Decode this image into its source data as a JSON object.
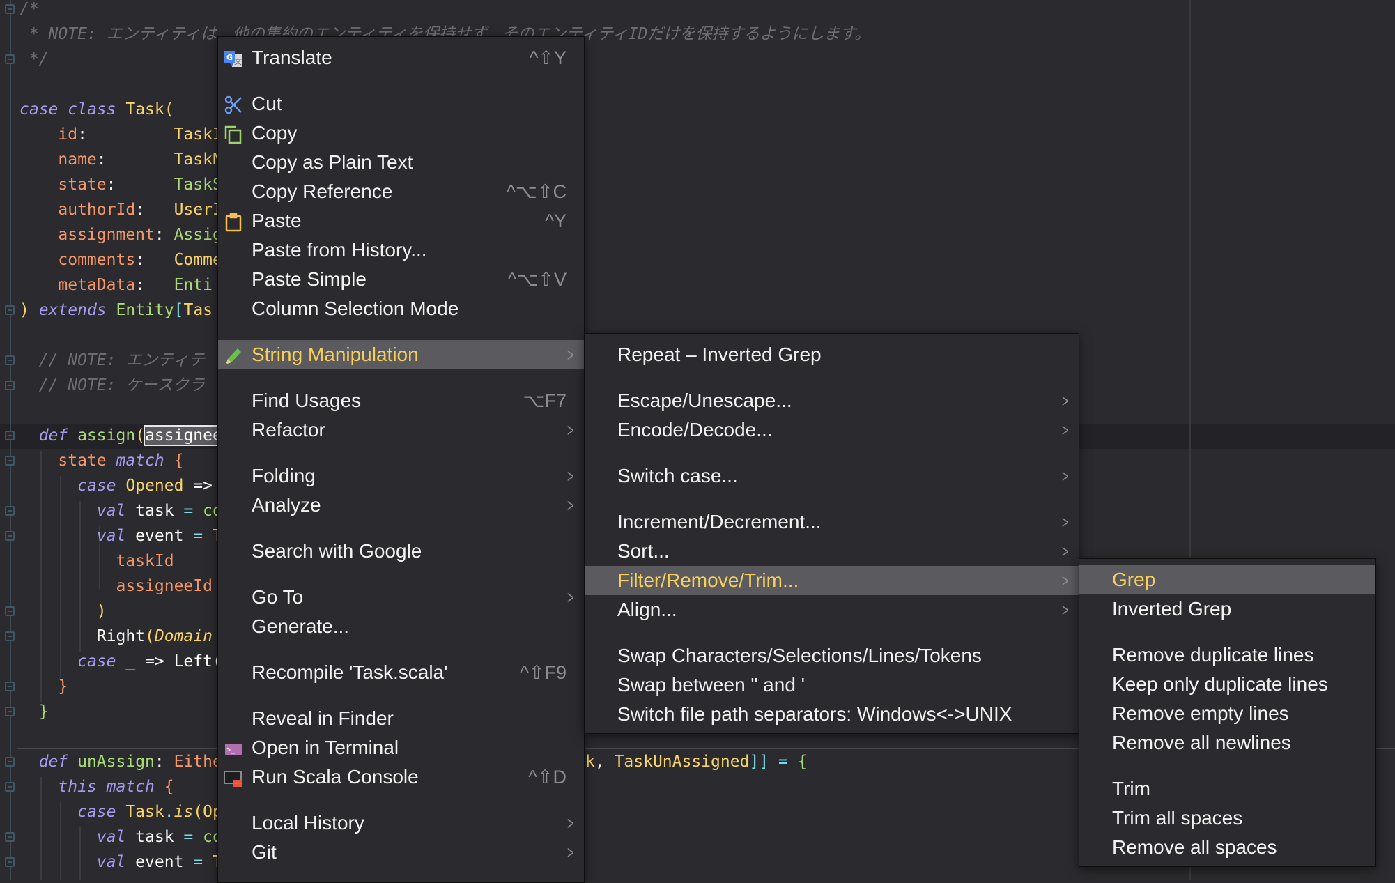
{
  "editor": {
    "lines": [
      {
        "n": 0,
        "tokens": [
          {
            "t": "/*",
            "k": "c"
          }
        ]
      },
      {
        "n": 1,
        "tokens": [
          {
            "t": " * NOTE: エンティティは、他の集約のエンティティを保持せず、そのエンティティIDだけを保持するようにします。",
            "k": "c"
          }
        ]
      },
      {
        "n": 2,
        "tokens": [
          {
            "t": " */",
            "k": "c"
          }
        ]
      },
      {
        "n": 4,
        "tokens": [
          {
            "t": "case",
            "k": "kw"
          },
          {
            "t": " ",
            "k": "pl"
          },
          {
            "t": "class",
            "k": "kw"
          },
          {
            "t": " ",
            "k": "pl"
          },
          {
            "t": "Task",
            "k": "ty"
          },
          {
            "t": "(",
            "k": "ty"
          }
        ]
      },
      {
        "n": 5,
        "tokens": [
          {
            "t": "    ",
            "k": "pl"
          },
          {
            "t": "id",
            "k": "pa"
          },
          {
            "t": ":         ",
            "k": "pl"
          },
          {
            "t": "TaskI",
            "k": "ty"
          }
        ]
      },
      {
        "n": 6,
        "tokens": [
          {
            "t": "    ",
            "k": "pl"
          },
          {
            "t": "name",
            "k": "pa"
          },
          {
            "t": ":       ",
            "k": "pl"
          },
          {
            "t": "TaskN",
            "k": "ty"
          }
        ]
      },
      {
        "n": 7,
        "tokens": [
          {
            "t": "    ",
            "k": "pl"
          },
          {
            "t": "state",
            "k": "pa"
          },
          {
            "t": ":      ",
            "k": "pl"
          },
          {
            "t": "TaskS",
            "k": "gr"
          }
        ]
      },
      {
        "n": 8,
        "tokens": [
          {
            "t": "    ",
            "k": "pl"
          },
          {
            "t": "authorId",
            "k": "pa"
          },
          {
            "t": ":   ",
            "k": "pl"
          },
          {
            "t": "UserI",
            "k": "ty"
          }
        ]
      },
      {
        "n": 9,
        "tokens": [
          {
            "t": "    ",
            "k": "pl"
          },
          {
            "t": "assignment",
            "k": "pa"
          },
          {
            "t": ": ",
            "k": "pl"
          },
          {
            "t": "Assig",
            "k": "gr"
          }
        ]
      },
      {
        "n": 10,
        "tokens": [
          {
            "t": "    ",
            "k": "pl"
          },
          {
            "t": "comments",
            "k": "pa"
          },
          {
            "t": ":   ",
            "k": "pl"
          },
          {
            "t": "Comme",
            "k": "ty"
          }
        ]
      },
      {
        "n": 11,
        "tokens": [
          {
            "t": "    ",
            "k": "pl"
          },
          {
            "t": "metaData",
            "k": "pa"
          },
          {
            "t": ":   ",
            "k": "pl"
          },
          {
            "t": "Enti",
            "k": "gr"
          }
        ]
      },
      {
        "n": 12,
        "tokens": [
          {
            "t": ")",
            "k": "ty"
          },
          {
            "t": " ",
            "k": "pl"
          },
          {
            "t": "extends",
            "k": "kw"
          },
          {
            "t": " ",
            "k": "pl"
          },
          {
            "t": "Entity",
            "k": "gr"
          },
          {
            "t": "[",
            "k": "op"
          },
          {
            "t": "Tas",
            "k": "ty"
          }
        ]
      },
      {
        "n": 14,
        "tokens": [
          {
            "t": "  // NOTE: エンティテ",
            "k": "c"
          }
        ]
      },
      {
        "n": 15,
        "tokens": [
          {
            "t": "  // NOTE: ケースクラ",
            "k": "c"
          }
        ]
      },
      {
        "n": 17,
        "tokens": [
          {
            "t": "  ",
            "k": "pl"
          },
          {
            "t": "def",
            "k": "kw"
          },
          {
            "t": " ",
            "k": "pl"
          },
          {
            "t": "assign",
            "k": "gr"
          },
          {
            "t": "(",
            "k": "ty"
          },
          {
            "t": "assignee",
            "k": "sel"
          }
        ]
      },
      {
        "n": 18,
        "tokens": [
          {
            "t": "    ",
            "k": "pl"
          },
          {
            "t": "state",
            "k": "pa"
          },
          {
            "t": " ",
            "k": "pl"
          },
          {
            "t": "match",
            "k": "kw"
          },
          {
            "t": " ",
            "k": "pl"
          },
          {
            "t": "{",
            "k": "pa"
          }
        ]
      },
      {
        "n": 19,
        "tokens": [
          {
            "t": "      ",
            "k": "pl"
          },
          {
            "t": "case",
            "k": "kw"
          },
          {
            "t": " ",
            "k": "pl"
          },
          {
            "t": "Opened",
            "k": "ty"
          },
          {
            "t": " =>",
            "k": "pl"
          }
        ]
      },
      {
        "n": 20,
        "tokens": [
          {
            "t": "        ",
            "k": "pl"
          },
          {
            "t": "val",
            "k": "kw"
          },
          {
            "t": " task ",
            "k": "pl"
          },
          {
            "t": "=",
            "k": "op"
          },
          {
            "t": " ",
            "k": "pl"
          },
          {
            "t": "co",
            "k": "gr"
          }
        ]
      },
      {
        "n": 21,
        "tokens": [
          {
            "t": "        ",
            "k": "pl"
          },
          {
            "t": "val",
            "k": "kw"
          },
          {
            "t": " event ",
            "k": "pl"
          },
          {
            "t": "=",
            "k": "op"
          },
          {
            "t": " T",
            "k": "ty"
          }
        ]
      },
      {
        "n": 22,
        "tokens": [
          {
            "t": "          ",
            "k": "pl"
          },
          {
            "t": "taskId",
            "k": "pa"
          }
        ]
      },
      {
        "n": 23,
        "tokens": [
          {
            "t": "          ",
            "k": "pl"
          },
          {
            "t": "assigneeId",
            "k": "pa"
          }
        ]
      },
      {
        "n": 24,
        "tokens": [
          {
            "t": "        ",
            "k": "pl"
          },
          {
            "t": ")",
            "k": "ty"
          }
        ]
      },
      {
        "n": 25,
        "tokens": [
          {
            "t": "        Right",
            "k": "pl"
          },
          {
            "t": "(",
            "k": "ty"
          },
          {
            "t": "Domain",
            "k": "tyi"
          }
        ]
      },
      {
        "n": 26,
        "tokens": [
          {
            "t": "      ",
            "k": "pl"
          },
          {
            "t": "case",
            "k": "kw"
          },
          {
            "t": " _ => Left(",
            "k": "pl"
          }
        ]
      },
      {
        "n": 27,
        "tokens": [
          {
            "t": "    ",
            "k": "pl"
          },
          {
            "t": "}",
            "k": "pa"
          }
        ]
      },
      {
        "n": 28,
        "tokens": [
          {
            "t": "  ",
            "k": "pl"
          },
          {
            "t": "}",
            "k": "gr"
          }
        ]
      },
      {
        "n": 30,
        "tokens": [
          {
            "t": "  ",
            "k": "pl"
          },
          {
            "t": "def",
            "k": "kw"
          },
          {
            "t": " ",
            "k": "pl"
          },
          {
            "t": "unAssign",
            "k": "gr"
          },
          {
            "t": ": ",
            "k": "pl"
          },
          {
            "t": "Eithe",
            "k": "pa"
          }
        ],
        "suffix": [
          {
            "t": "k",
            "k": "ty"
          },
          {
            "t": ", ",
            "k": "pl"
          },
          {
            "t": "TaskUnAssigned",
            "k": "ty"
          },
          {
            "t": "]]",
            "k": "op"
          },
          {
            "t": " = ",
            "k": "op"
          },
          {
            "t": "{",
            "k": "gr"
          }
        ]
      },
      {
        "n": 31,
        "tokens": [
          {
            "t": "    ",
            "k": "pl"
          },
          {
            "t": "this",
            "k": "kw"
          },
          {
            "t": " ",
            "k": "pl"
          },
          {
            "t": "match",
            "k": "kw"
          },
          {
            "t": " ",
            "k": "pl"
          },
          {
            "t": "{",
            "k": "pa"
          }
        ]
      },
      {
        "n": 32,
        "tokens": [
          {
            "t": "      ",
            "k": "pl"
          },
          {
            "t": "case",
            "k": "kw"
          },
          {
            "t": " ",
            "k": "pl"
          },
          {
            "t": "Task",
            "k": "ty"
          },
          {
            "t": ".",
            "k": "op"
          },
          {
            "t": "is",
            "k": "tyi"
          },
          {
            "t": "(Op",
            "k": "ty"
          }
        ]
      },
      {
        "n": 33,
        "tokens": [
          {
            "t": "        ",
            "k": "pl"
          },
          {
            "t": "val",
            "k": "kw"
          },
          {
            "t": " task ",
            "k": "pl"
          },
          {
            "t": "=",
            "k": "op"
          },
          {
            "t": " ",
            "k": "pl"
          },
          {
            "t": "co",
            "k": "gr"
          }
        ]
      },
      {
        "n": 34,
        "tokens": [
          {
            "t": "        ",
            "k": "pl"
          },
          {
            "t": "val",
            "k": "kw"
          },
          {
            "t": " event ",
            "k": "pl"
          },
          {
            "t": "=",
            "k": "op"
          },
          {
            "t": " T",
            "k": "ty"
          }
        ]
      }
    ],
    "fold_lines": [
      0,
      2,
      12,
      14,
      15,
      17,
      18,
      20,
      21,
      24,
      25,
      27,
      28,
      30,
      31,
      33,
      34
    ]
  },
  "context_menu": {
    "items": [
      {
        "label": "Translate",
        "shortcut": "^⇧Y",
        "icon": "translate-icon"
      },
      {
        "separator": true
      },
      {
        "label": "Cut",
        "icon": "scissors-icon"
      },
      {
        "label": "Copy",
        "icon": "copy-icon"
      },
      {
        "label": "Copy as Plain Text"
      },
      {
        "label": "Copy Reference",
        "shortcut": "^⌥⇧C"
      },
      {
        "label": "Paste",
        "shortcut": "^Y",
        "icon": "clipboard-icon"
      },
      {
        "label": "Paste from History..."
      },
      {
        "label": "Paste Simple",
        "shortcut": "^⌥⇧V"
      },
      {
        "label": "Column Selection Mode"
      },
      {
        "separator": true
      },
      {
        "label": "String Manipulation",
        "submenu": true,
        "highlighted": true,
        "icon": "pencil-icon"
      },
      {
        "separator": true
      },
      {
        "label": "Find Usages",
        "shortcut": "⌥F7"
      },
      {
        "label": "Refactor",
        "submenu": true
      },
      {
        "separator": true
      },
      {
        "label": "Folding",
        "submenu": true
      },
      {
        "label": "Analyze",
        "submenu": true
      },
      {
        "separator": true
      },
      {
        "label": "Search with Google"
      },
      {
        "separator": true
      },
      {
        "label": "Go To",
        "submenu": true
      },
      {
        "label": "Generate..."
      },
      {
        "separator": true
      },
      {
        "label": "Recompile 'Task.scala'",
        "shortcut": "^⇧F9"
      },
      {
        "separator": true
      },
      {
        "label": "Reveal in Finder"
      },
      {
        "label": "Open in Terminal",
        "icon": "terminal-icon"
      },
      {
        "label": "Run Scala Console",
        "shortcut": "^⇧D",
        "icon": "scala-console-icon"
      },
      {
        "separator": true
      },
      {
        "label": "Local History",
        "submenu": true
      },
      {
        "label": "Git",
        "submenu": true
      }
    ]
  },
  "string_manipulation_menu": {
    "items": [
      {
        "label": "Repeat – Inverted Grep"
      },
      {
        "separator": true
      },
      {
        "label": "Escape/Unescape...",
        "submenu": true
      },
      {
        "label": "Encode/Decode...",
        "submenu": true
      },
      {
        "separator": true
      },
      {
        "label": "Switch case...",
        "submenu": true
      },
      {
        "separator": true
      },
      {
        "label": "Increment/Decrement...",
        "submenu": true
      },
      {
        "label": "Sort...",
        "submenu": true
      },
      {
        "label": "Filter/Remove/Trim...",
        "submenu": true,
        "highlighted": true
      },
      {
        "label": "Align...",
        "submenu": true
      },
      {
        "separator": true
      },
      {
        "label": "Swap Characters/Selections/Lines/Tokens"
      },
      {
        "label": "Swap between \" and '"
      },
      {
        "label": "Switch file path separators: Windows<->UNIX"
      }
    ]
  },
  "filter_menu": {
    "items": [
      {
        "label": "Grep",
        "highlighted": true
      },
      {
        "label": "Inverted Grep"
      },
      {
        "separator": true
      },
      {
        "label": "Remove duplicate lines"
      },
      {
        "label": "Keep only duplicate lines"
      },
      {
        "label": "Remove empty lines"
      },
      {
        "label": "Remove all newlines"
      },
      {
        "separator": true
      },
      {
        "label": "Trim"
      },
      {
        "label": "Trim all spaces"
      },
      {
        "label": "Remove all spaces"
      }
    ]
  },
  "colors": {
    "highlight_text": "#f8cf5c",
    "highlight_bg": "#5b5a5f",
    "menu_bg": "#2b2a2e",
    "editor_bg": "#2b2a2e"
  }
}
